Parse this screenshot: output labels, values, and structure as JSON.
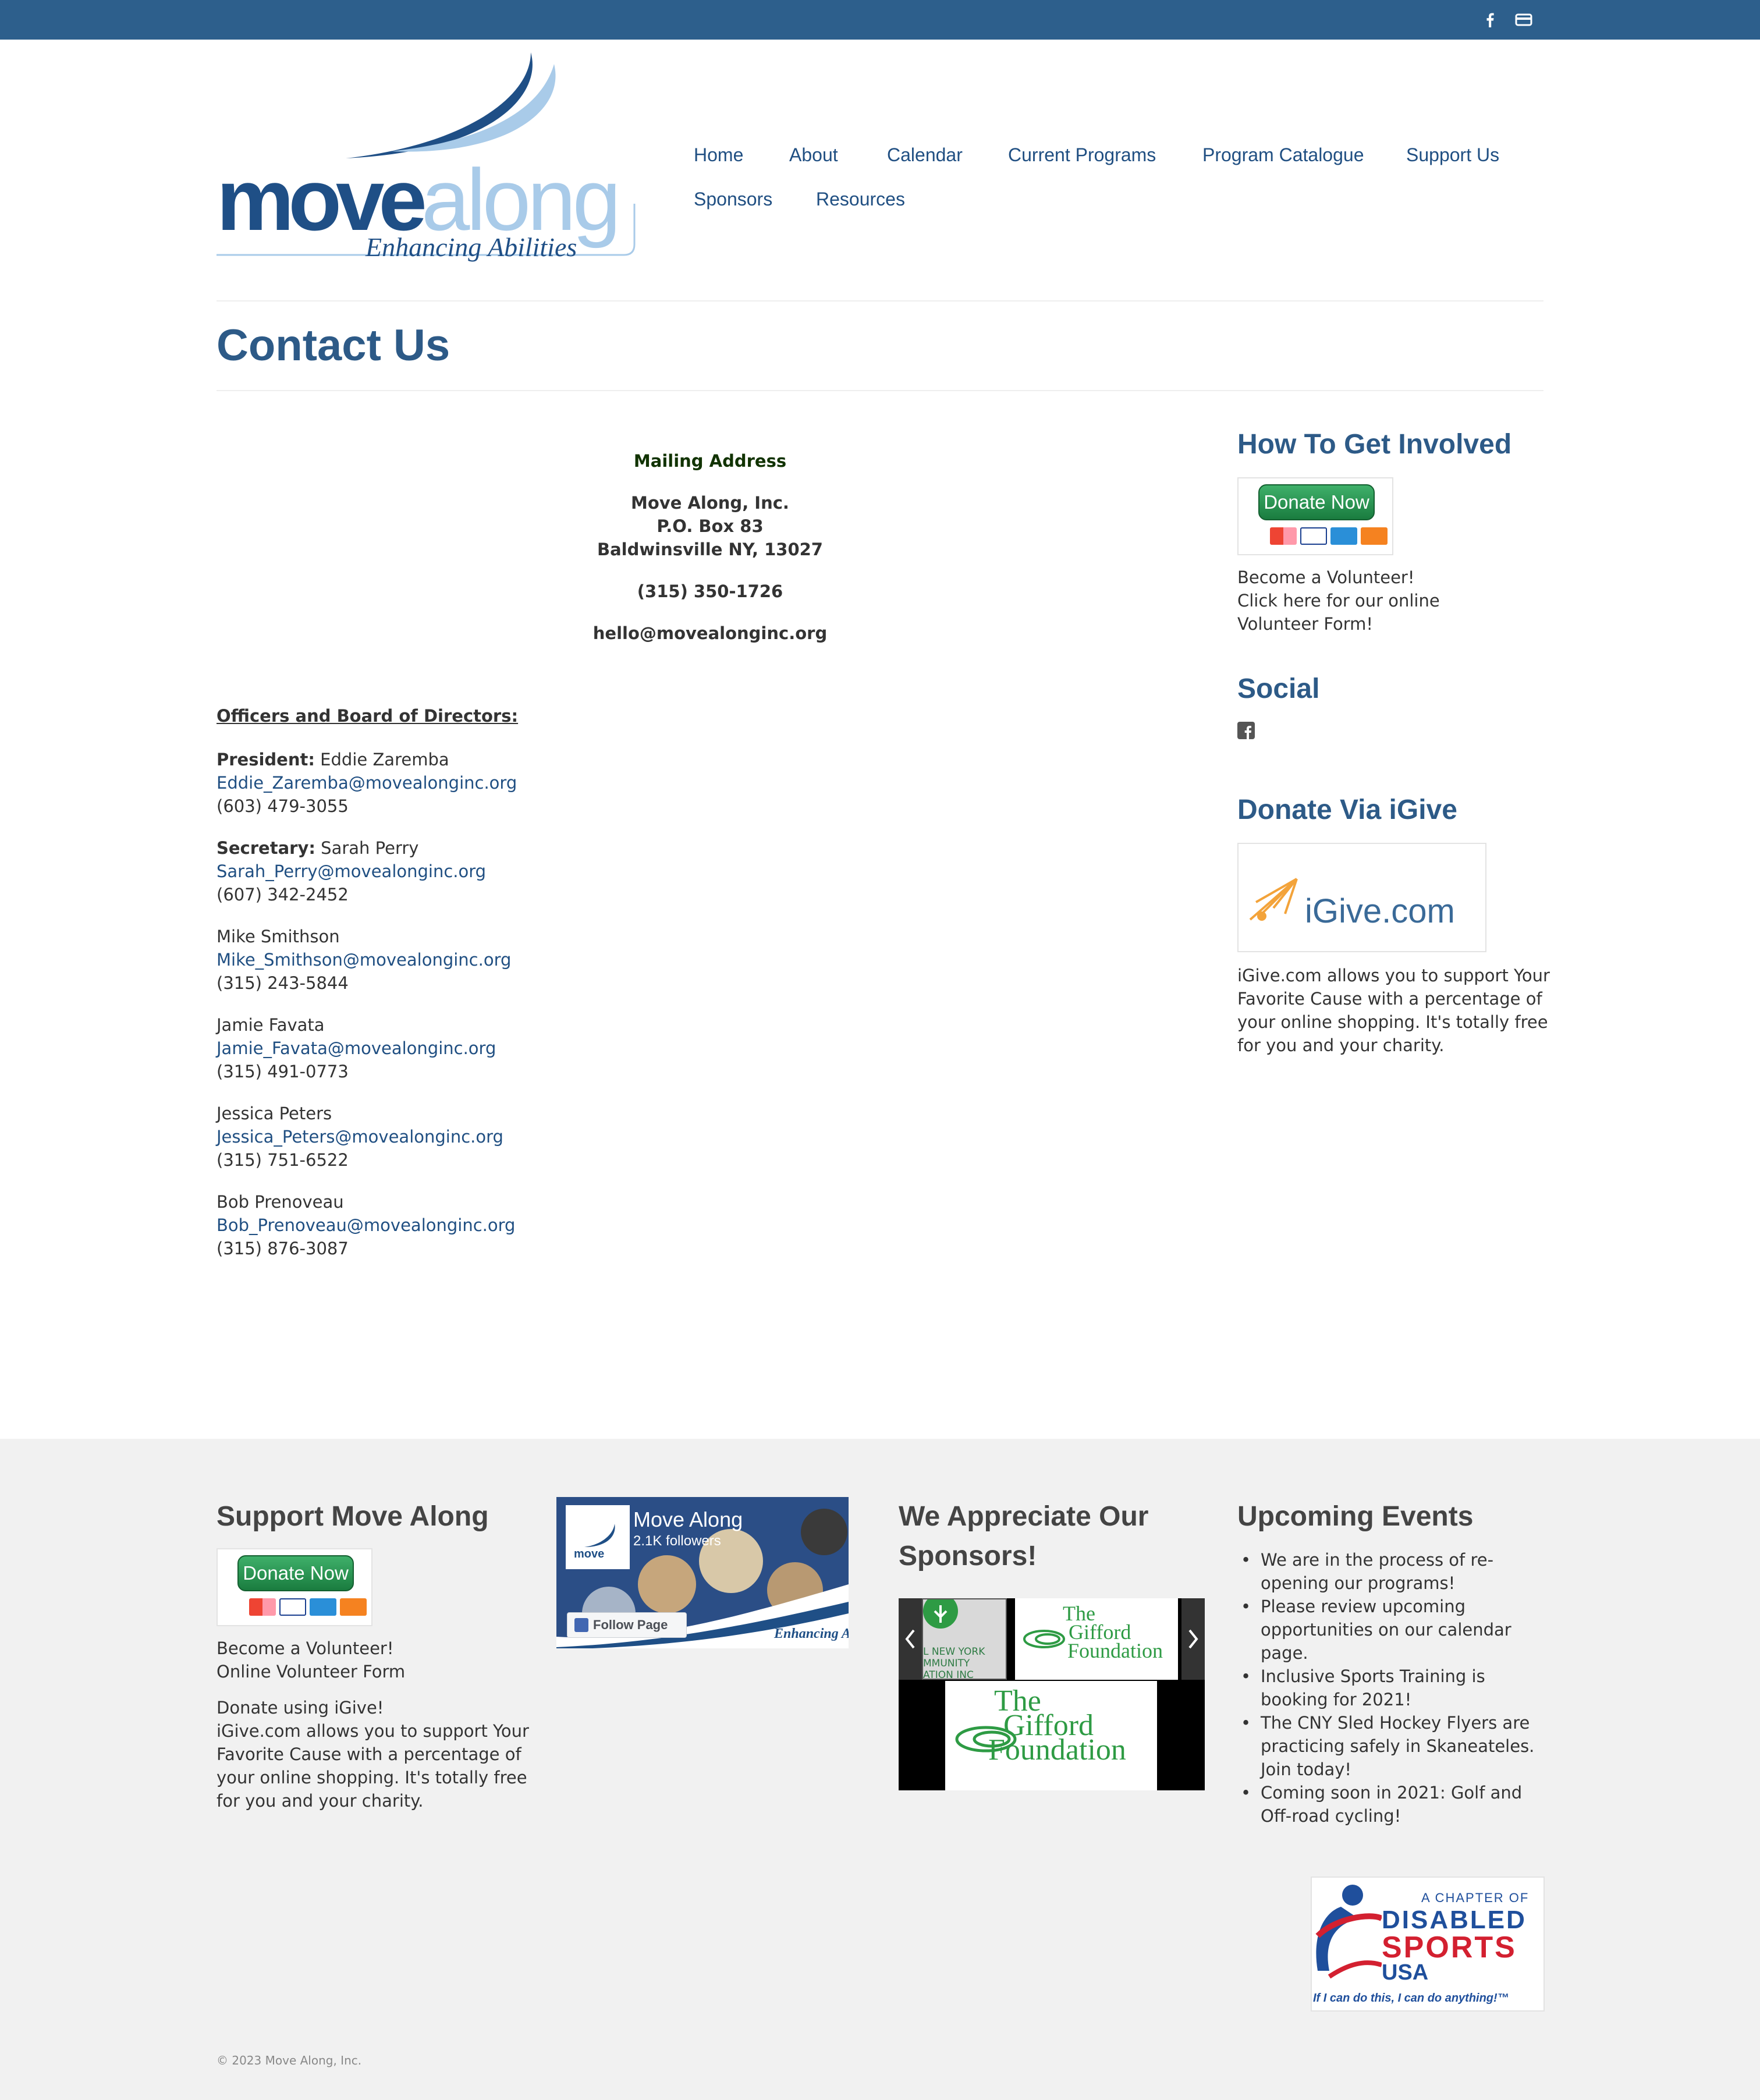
{
  "topbar": {
    "icons": [
      "facebook-icon",
      "card-icon"
    ],
    "color": "#2d5f8c"
  },
  "logo": {
    "word1": "move",
    "word2": "along",
    "tagline": "Enhancing Abilities"
  },
  "nav": {
    "home": "Home",
    "about": "About",
    "calendar": "Calendar",
    "current_programs": "Current Programs",
    "program_catalogue": "Program Catalogue",
    "support_us": "Support Us",
    "sponsors": "Sponsors",
    "resources": "Resources"
  },
  "page": {
    "title": "Contact Us"
  },
  "mailing": {
    "heading": "Mailing Address",
    "name": "Move Along, Inc.",
    "box": "P.O. Box 83",
    "city": "Baldwinsville NY,  13027",
    "phone": "(315) 350-1726",
    "email": "hello@movealonginc.org"
  },
  "officers": {
    "heading": "Officers and Board of Directors:",
    "people": [
      {
        "role": "President:",
        "name": " Eddie Zaremba",
        "email": "Eddie_Zaremba@movealonginc.org",
        "phone": "(603) 479-3055"
      },
      {
        "role": "Secretary:",
        "name": " Sarah Perry",
        "email": "Sarah_Perry@movealonginc.org",
        "phone": "(607) 342-2452"
      },
      {
        "role": "",
        "name": "Mike Smithson",
        "email": "Mike_Smithson@movealonginc.org",
        "phone": "(315) 243-5844"
      },
      {
        "role": "",
        "name": "Jamie Favata",
        "email": "Jamie_Favata@movealonginc.org",
        "phone": "(315) 491-0773"
      },
      {
        "role": "",
        "name": "Jessica Peters",
        "email": "Jessica_Peters@movealonginc.org",
        "phone": "(315) 751-6522"
      },
      {
        "role": "",
        "name": "Bob Prenoveau",
        "email": "Bob_Prenoveau@movealonginc.org",
        "phone": "(315) 876-3087"
      }
    ]
  },
  "sidebar": {
    "involved_heading": "How To Get Involved",
    "donate_label": "Donate Now",
    "volunteer_1": "Become a Volunteer!",
    "volunteer_2": "Click here for our online",
    "volunteer_3": "Volunteer Form!",
    "social_heading": "Social",
    "igive_heading": "Donate Via iGive",
    "igive_logo": "iGive.com",
    "igive_text": [
      "iGive.com allows you to support Your",
      "Favorite Cause with a percentage of",
      "your online shopping. It's totally free",
      "for you and your charity."
    ]
  },
  "footer": {
    "support_heading": "Support Move Along",
    "donate_label": "Donate Now",
    "volunteer_1": "Become a Volunteer!",
    "volunteer_2": "Online Volunteer Form",
    "igive_lines": [
      "Donate using iGive!",
      "iGive.com allows you to support Your",
      "Favorite Cause with a percentage of",
      "your online shopping. It's totally free",
      "for you and your charity."
    ],
    "fb": {
      "name": "Move Along",
      "followers": "2.1K followers",
      "follow": "Follow Page",
      "banner": "Enhancing A"
    },
    "sponsors_heading_1": "We Appreciate Our",
    "sponsors_heading_2": "Sponsors!",
    "sponsor_left": [
      "L NEW YORK",
      "MMUNITY",
      "ATION INC"
    ],
    "gifford": [
      "The",
      "Gifford",
      "Foundation"
    ],
    "events_heading": "Upcoming Events",
    "events": [
      "We are in the process of re-opening our programs!",
      "Please review upcoming opportunities on our calendar page.",
      "Inclusive Sports Training is booking for 2021!",
      "The CNY Sled Hockey Flyers are practicing safely in Skaneateles. Join today!",
      "Coming soon in 2021: Golf and Off-road cycling!"
    ],
    "dsusa": {
      "line1": "A CHAPTER OF",
      "line2": "DISABLED",
      "line3": "SPORTS",
      "line4": "USA",
      "tag": "If I can do this, I can do anything!™"
    },
    "copyright": "© 2023 Move Along, Inc."
  }
}
